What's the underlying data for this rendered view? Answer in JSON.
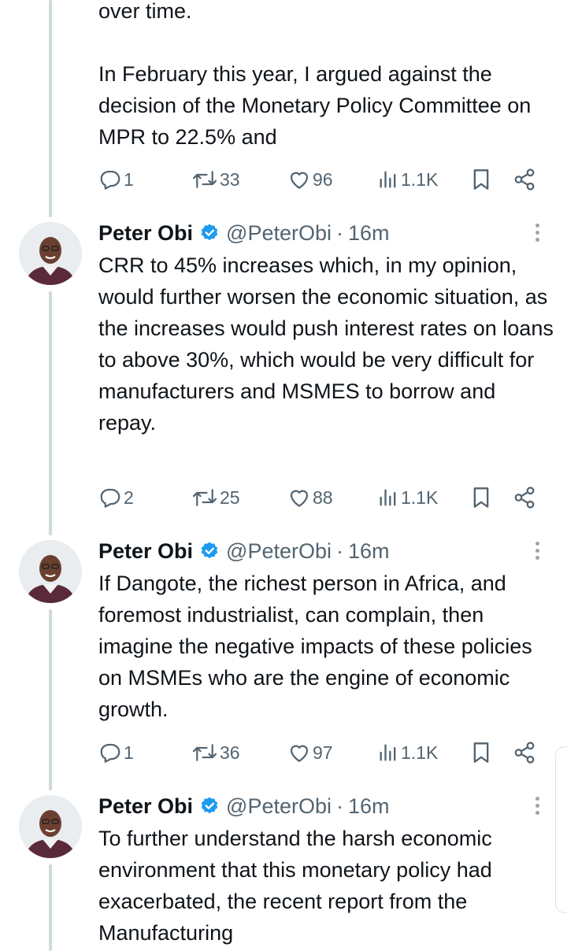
{
  "first_tweet": {
    "text": "over time.\n\nIn February this year, I argued against the decision of the Monetary Policy Committee on MPR to 22.5% and",
    "actions": {
      "replies": "1",
      "reposts": "33",
      "likes": "96",
      "views": "1.1K"
    }
  },
  "tweets": [
    {
      "name": "Peter Obi",
      "handle": "@PeterObi",
      "separator": "·",
      "time": "16m",
      "text": "CRR to 45% increases which, in my opinion, would further worsen the economic situation, as the increases would push interest rates on loans to above 30%, which would be very difficult for manufacturers and MSMES to borrow and repay.",
      "actions": {
        "replies": "2",
        "reposts": "25",
        "likes": "88",
        "views": "1.1K"
      }
    },
    {
      "name": "Peter Obi",
      "handle": "@PeterObi",
      "separator": "·",
      "time": "16m",
      "text": "If Dangote, the richest person in Africa, and foremost industrialist, can complain, then imagine the negative impacts of these policies on MSMEs who are the engine of economic growth.",
      "actions": {
        "replies": "1",
        "reposts": "36",
        "likes": "97",
        "views": "1.1K"
      }
    },
    {
      "name": "Peter Obi",
      "handle": "@PeterObi",
      "separator": "·",
      "time": "16m",
      "text": "To further understand the harsh economic environment that this monetary policy had exacerbated, the recent report from the Manufacturing"
    }
  ],
  "icons": {
    "reply": "reply-icon",
    "repost": "repost-icon",
    "like": "heart-icon",
    "views": "views-icon",
    "bookmark": "bookmark-icon",
    "share": "share-icon",
    "verified": "verified-badge-icon",
    "more": "more-vertical-icon"
  },
  "colors": {
    "text": "#0f1419",
    "secondary": "#536471",
    "verified": "#1d9bf0",
    "thread_line": "#cfd9de"
  }
}
